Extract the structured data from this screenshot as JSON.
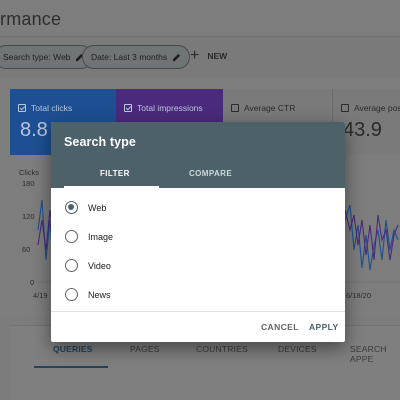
{
  "header": {
    "title": "rmance"
  },
  "filters": {
    "chips": [
      {
        "label": "Search type: Web"
      },
      {
        "label": "Date: Last 3 months"
      }
    ],
    "new_label": "NEW"
  },
  "metrics": [
    {
      "label": "Total clicks",
      "value": "8.8",
      "checked": true
    },
    {
      "label": "Total impressions",
      "value": "",
      "checked": true
    },
    {
      "label": "Average CTR",
      "value": "",
      "checked": false
    },
    {
      "label": "Average posi",
      "value": "43.9",
      "checked": false
    }
  ],
  "chart": {
    "ylabel": "Clicks",
    "yticks": [
      "180",
      "120",
      "60",
      "0"
    ],
    "xticks": [
      "4/19",
      "6/18/20"
    ]
  },
  "bg_tabs": [
    "QUERIES",
    "PAGES",
    "COUNTRIES",
    "DEVICES",
    "SEARCH APPE"
  ],
  "dialog": {
    "title": "Search type",
    "tabs": [
      "FILTER",
      "COMPARE"
    ],
    "options": [
      {
        "label": "Web",
        "selected": true
      },
      {
        "label": "Image",
        "selected": false
      },
      {
        "label": "Video",
        "selected": false
      },
      {
        "label": "News",
        "selected": false
      }
    ],
    "cancel_label": "CANCEL",
    "apply_label": "APPLY"
  },
  "colors": {
    "dialog_header": "#4c616a",
    "clicks_card": "#1d4f92",
    "impressions_card": "#4a2a7c"
  }
}
